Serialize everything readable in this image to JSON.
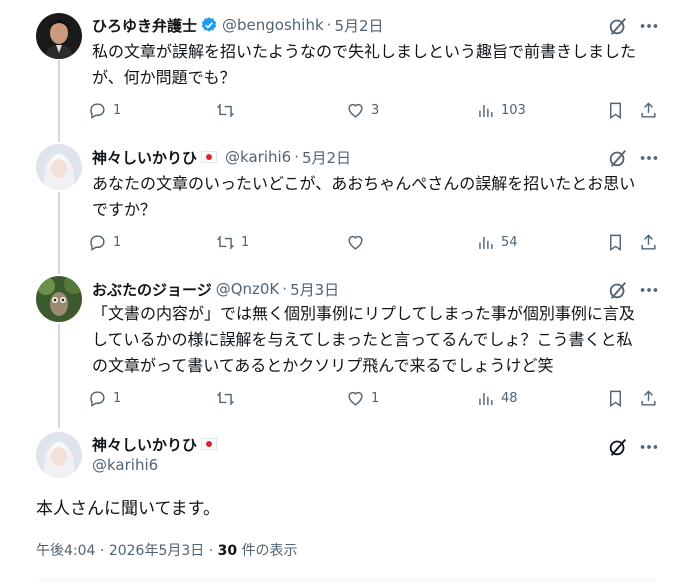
{
  "tweets": [
    {
      "name": "ひろゆき弁護士",
      "handle": "@bengoshihk",
      "date": "5月2日",
      "text": "私の文章が誤解を招いたようなので失礼しましという趣旨で前書きしました\nが、何か問題でも？",
      "replies": "1",
      "retweets": "",
      "likes": "3",
      "views": "103"
    },
    {
      "name": "神々しいかりひ",
      "handle": "@karihi6",
      "date": "5月2日",
      "text": "あなたの文章のいったいどこが、あおちゃんぺさんの誤解を招いたとお思い\nですか？",
      "replies": "1",
      "retweets": "1",
      "likes": "",
      "views": "54"
    },
    {
      "name": "おぶたのジョージ",
      "handle": "@Qnz0K",
      "date": "5月3日",
      "text": "「文書の内容が」では無く個別事例にリプしてしまった事が個別事例に言及\nしているかの様に誤解を与えてしまったと言ってるんでしょ？こう書くと私\nの文章がって書いてあるとかクソリプ飛んで来るでしょうけど笑",
      "replies": "1",
      "retweets": "",
      "likes": "1",
      "views": "48"
    }
  ],
  "main": {
    "name": "神々しいかりひ",
    "handle": "@karihi6",
    "text": "本人さんに聞いてます。",
    "time": "午後4:04",
    "date": "2026年5月3日",
    "views_count": "30",
    "views_label": "件の表示"
  },
  "colors": {
    "text": "#0f1419",
    "secondary": "#536471",
    "line": "#cfd9de",
    "verified": "#1d9bf0",
    "flag": "#e0242f"
  }
}
